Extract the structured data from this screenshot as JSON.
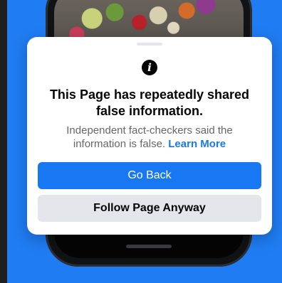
{
  "dialog": {
    "title": "This Page has repeatedly shared false information.",
    "subtitle": "Independent fact-checkers said the information is false.",
    "learn_more": "Learn More",
    "info_icon_glyph": "i"
  },
  "buttons": {
    "go_back": "Go Back",
    "follow_anyway": "Follow Page Anyway"
  },
  "colors": {
    "background_blue": "#1f7cf2",
    "primary_blue": "#1877f2",
    "secondary_gray": "#e4e6eb",
    "text_dark": "#050505",
    "text_muted": "#65676b"
  },
  "icons": [
    "info-icon"
  ]
}
